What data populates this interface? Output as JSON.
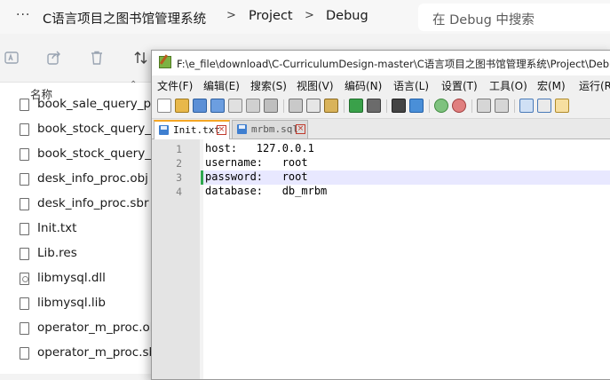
{
  "explorer": {
    "more_label": "···",
    "breadcrumbs": [
      "C语言项目之图书馆管理系统",
      "Project",
      "Debug"
    ],
    "separator": ">",
    "search_placeholder": "在 Debug 中搜索",
    "column_name": "名称",
    "sort_glyph": "⌃",
    "files": [
      {
        "name": "book_sale_query_proc",
        "icon": "file-icon"
      },
      {
        "name": "book_stock_query_proc",
        "icon": "file-icon"
      },
      {
        "name": "book_stock_query_proc",
        "icon": "file-icon"
      },
      {
        "name": "desk_info_proc.obj",
        "icon": "file-icon"
      },
      {
        "name": "desk_info_proc.sbr",
        "icon": "file-icon"
      },
      {
        "name": "Init.txt",
        "icon": "file-icon"
      },
      {
        "name": "Lib.res",
        "icon": "file-icon"
      },
      {
        "name": "libmysql.dll",
        "icon": "dll-icon"
      },
      {
        "name": "libmysql.lib",
        "icon": "file-icon"
      },
      {
        "name": "operator_m_proc.obj",
        "icon": "file-icon"
      },
      {
        "name": "operator_m_proc.sbr",
        "icon": "file-icon"
      }
    ]
  },
  "notepad": {
    "title": "F:\\e_file\\download\\C-CurriculumDesign-master\\C语言项目之图书馆管理系统\\Project\\Debug\\",
    "menu": [
      "文件(F)",
      "编辑(E)",
      "搜索(S)",
      "视图(V)",
      "编码(N)",
      "语言(L)",
      "设置(T)",
      "工具(O)",
      "宏(M)",
      "运行(R)"
    ],
    "tabs": [
      {
        "label": "Init.txt",
        "active": true
      },
      {
        "label": "mrbm.sql",
        "active": false
      }
    ],
    "close_glyph": "×",
    "lines": [
      {
        "num": "1",
        "text": "host:   127.0.0.1"
      },
      {
        "num": "2",
        "text": "username:   root"
      },
      {
        "num": "3",
        "text": "password:   root"
      },
      {
        "num": "4",
        "text": "database:   db_mrbm"
      }
    ],
    "current_line": 3
  },
  "colors": {
    "accent_tab": "#f5a623",
    "caret_line": "#e8e8ff",
    "change_marker": "#2fa84f"
  }
}
